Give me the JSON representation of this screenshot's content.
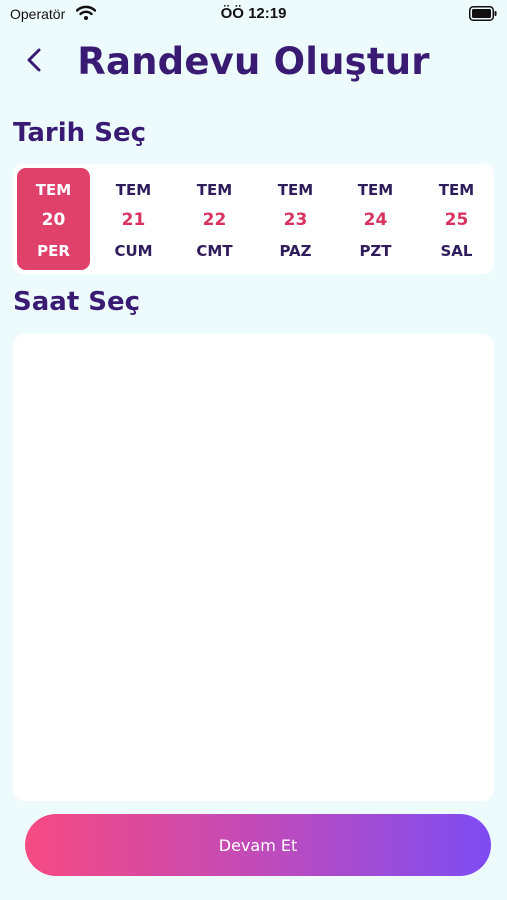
{
  "status_bar": {
    "carrier": "Operatör",
    "time": "ÖÖ 12:19"
  },
  "header": {
    "title": "Randevu Oluştur",
    "back_icon": "chevron-left-icon"
  },
  "date_section": {
    "title": "Tarih Seç",
    "selected_index": 0,
    "dates": [
      {
        "month": "TEM",
        "day": "20",
        "weekday": "PER"
      },
      {
        "month": "TEM",
        "day": "21",
        "weekday": "CUM"
      },
      {
        "month": "TEM",
        "day": "22",
        "weekday": "CMT"
      },
      {
        "month": "TEM",
        "day": "23",
        "weekday": "PAZ"
      },
      {
        "month": "TEM",
        "day": "24",
        "weekday": "PZT"
      },
      {
        "month": "TEM",
        "day": "25",
        "weekday": "SAL"
      }
    ]
  },
  "time_section": {
    "title": "Saat Seç"
  },
  "continue_button": {
    "label": "Devam Et"
  },
  "colors": {
    "title": "#3a1b74",
    "selected_date_bg": "#e0416a",
    "day_number": "#d8325f",
    "gradient_start": "#f64a82",
    "gradient_end": "#7d4cf3",
    "background": "#eefbfc"
  }
}
